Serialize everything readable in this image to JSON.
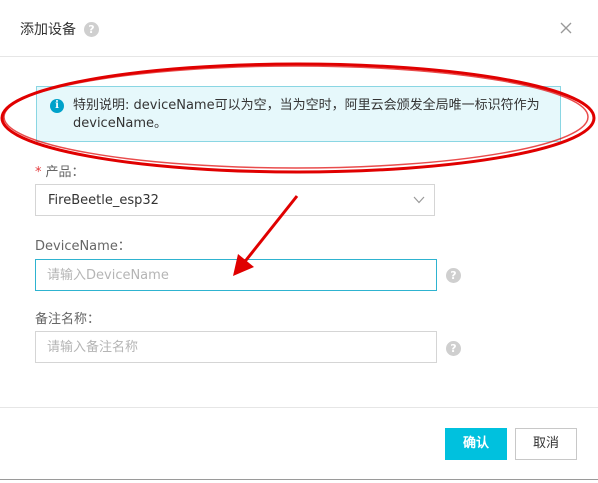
{
  "dialog": {
    "title": "添加设备",
    "help_icon": "question-mark-icon",
    "close_icon": "close-icon"
  },
  "notice": {
    "icon": "info-icon",
    "text": "特别说明: deviceName可以为空，当为空时，阿里云会颁发全局唯一标识符作为deviceName。"
  },
  "form": {
    "product": {
      "required_mark": "*",
      "label": "产品：",
      "value": "FireBeetle_esp32"
    },
    "device_name": {
      "label": "DeviceName：",
      "value": "",
      "placeholder": "请输入DeviceName"
    },
    "remark_name": {
      "label": "备注名称：",
      "value": "",
      "placeholder": "请输入备注名称"
    }
  },
  "footer": {
    "confirm_label": "确认",
    "cancel_label": "取消"
  },
  "colors": {
    "primary": "#00c1de",
    "notice_bg": "#e6f8fb",
    "notice_border": "#8ad6e3",
    "annotation": "#e00000",
    "required": "#e4393c"
  }
}
